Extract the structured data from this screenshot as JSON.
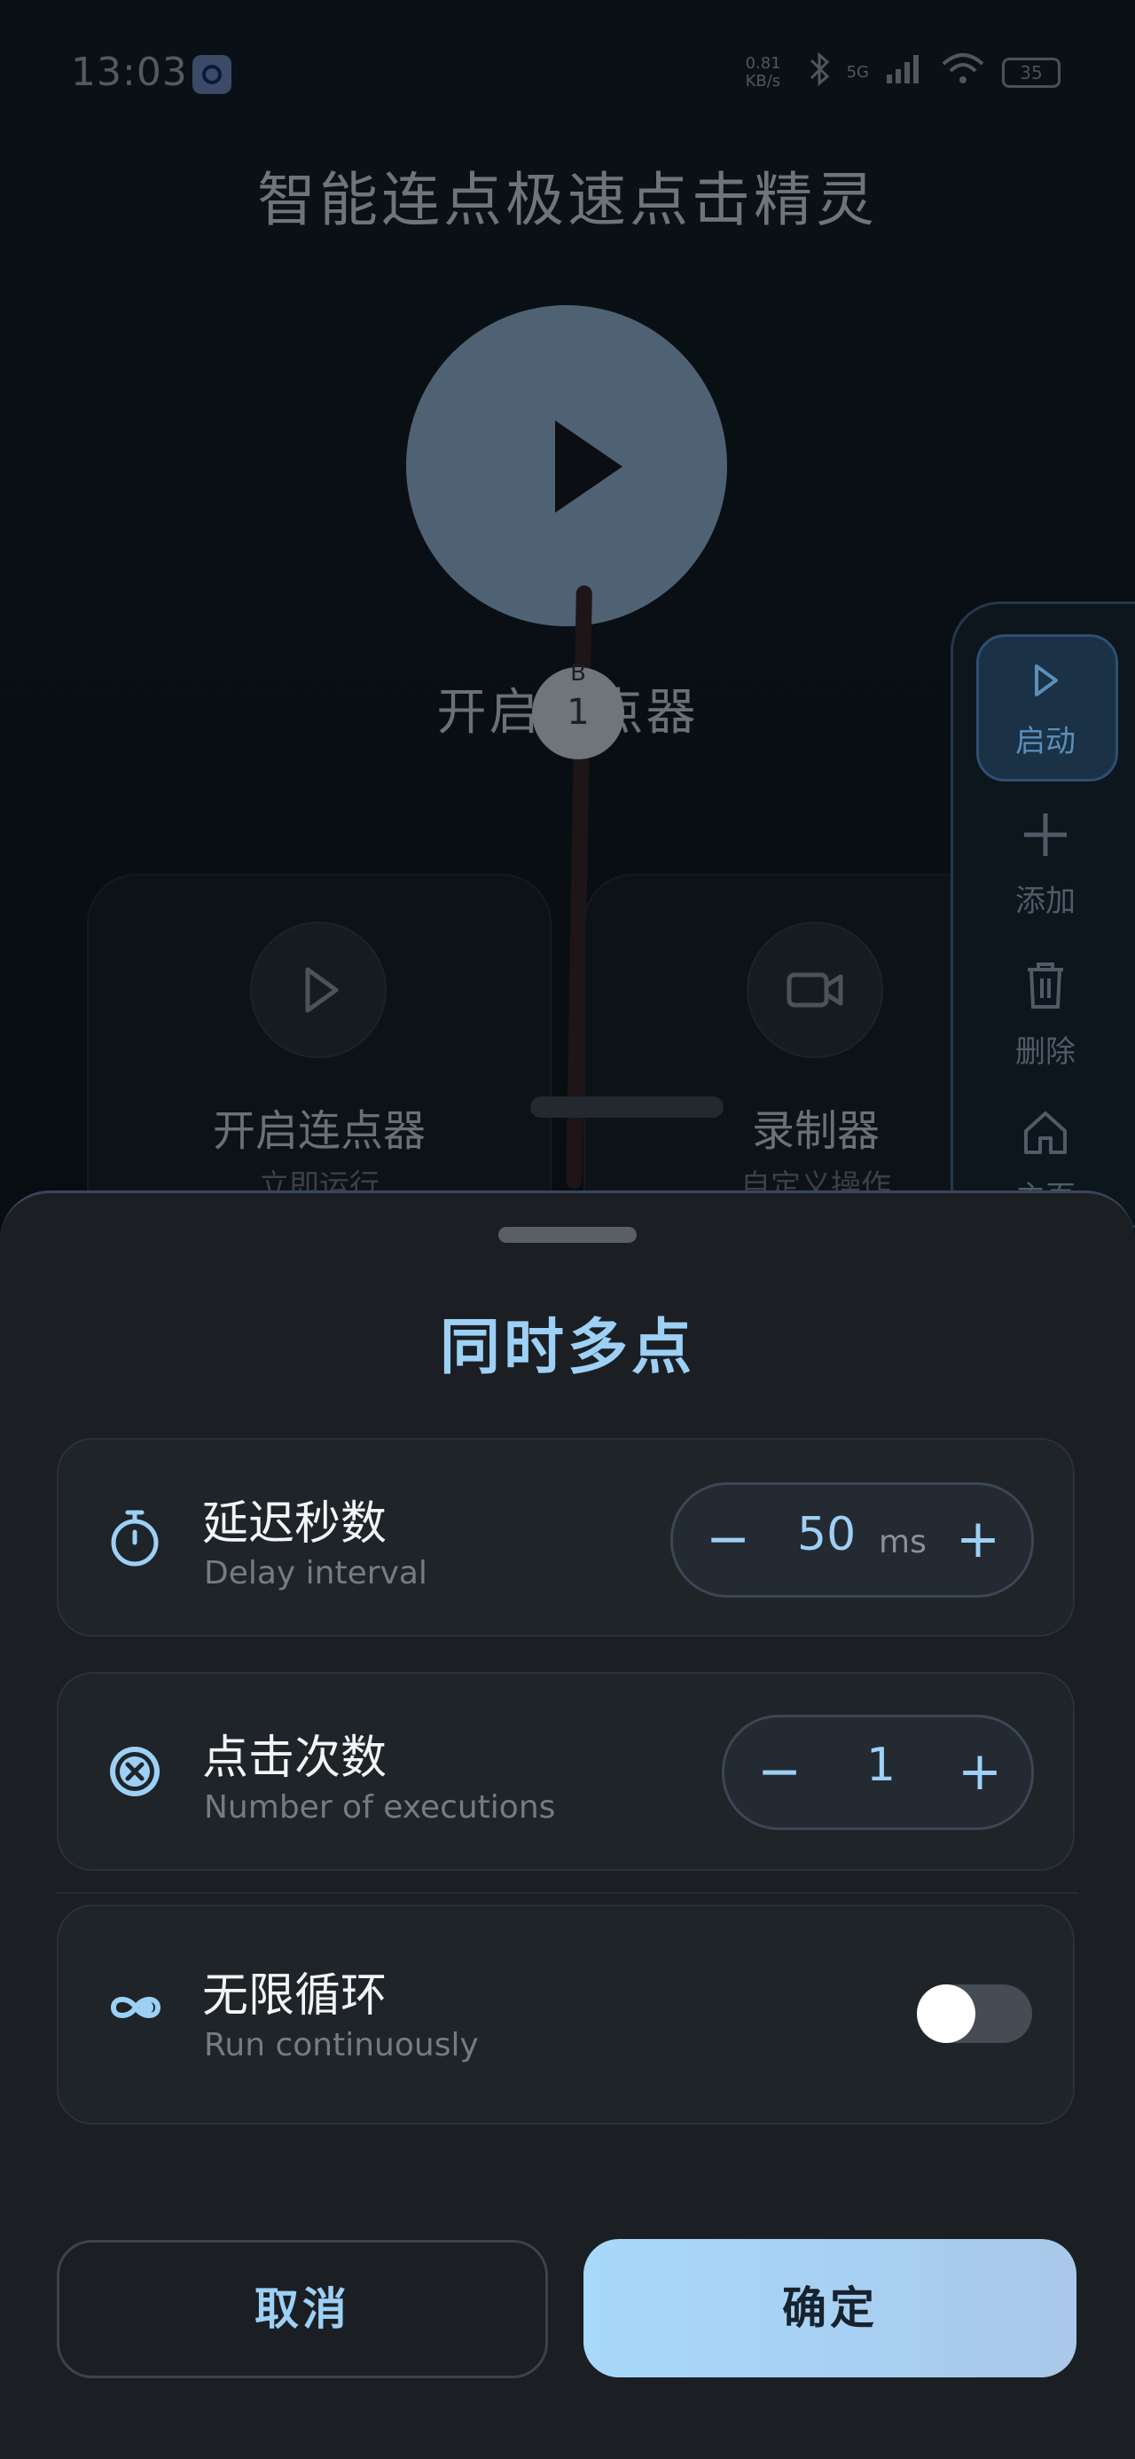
{
  "status_bar": {
    "time": "13:03",
    "net_speed": "0.81 KB/s",
    "signal": "5G",
    "battery": "35"
  },
  "app": {
    "title": "智能连点极速点击精灵",
    "start_label": "开启连点器",
    "node_b_label": "B",
    "node_b_number": "1",
    "cards": [
      {
        "title": "开启连点器",
        "subtitle": "立即运行",
        "icon": "play-icon"
      },
      {
        "title": "录制器",
        "subtitle": "自定义操作",
        "icon": "video-camera-icon"
      }
    ]
  },
  "floating_bar": {
    "items": [
      {
        "label": "启动",
        "icon": "play-icon",
        "active": true
      },
      {
        "label": "添加",
        "icon": "plus-icon"
      },
      {
        "label": "删除",
        "icon": "trash-icon"
      },
      {
        "label": "主页",
        "icon": "home-icon"
      }
    ]
  },
  "sheet": {
    "title": "同时多点",
    "rows": [
      {
        "title": "延迟秒数",
        "subtitle": "Delay interval",
        "icon": "timer-icon",
        "value": "50",
        "unit": "ms"
      },
      {
        "title": "点击次数",
        "subtitle": "Number of executions",
        "icon": "close-circle-icon",
        "value": "1"
      },
      {
        "title": "无限循环",
        "subtitle": "Run continuously",
        "icon": "infinity-icon",
        "toggle_on": false
      }
    ],
    "minus": "−",
    "plus": "+",
    "cancel_label": "取消",
    "confirm_label": "确定"
  },
  "colors": {
    "accent": "#9dd0f5",
    "sheet_bg": "#1b1f24",
    "confirm_bg": "#a7d9fb"
  }
}
